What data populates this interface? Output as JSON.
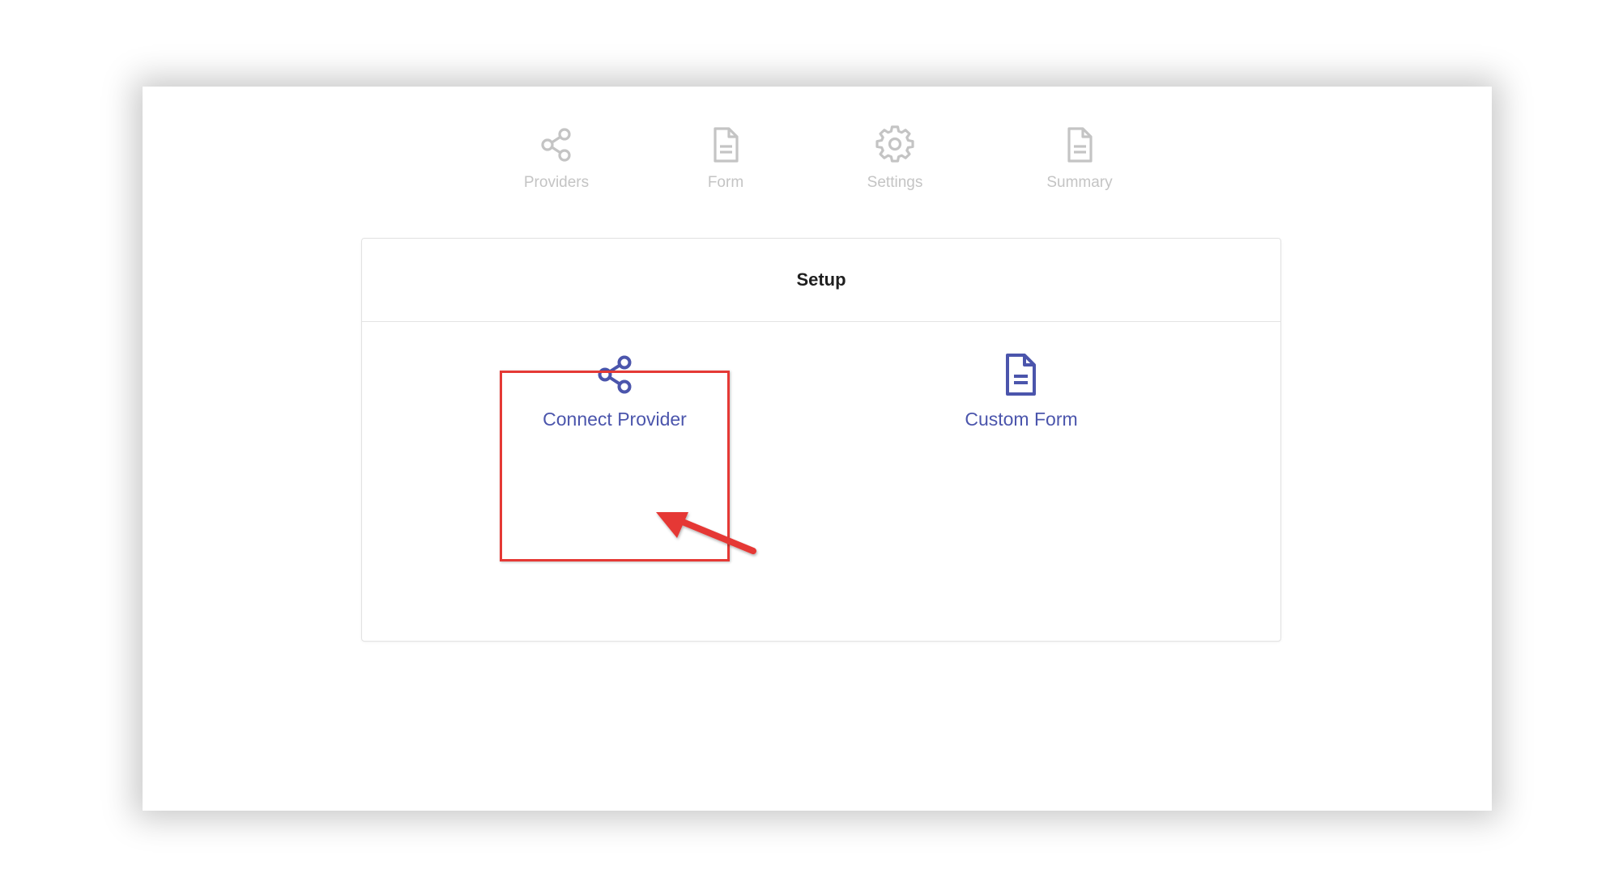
{
  "stepper": {
    "steps": [
      {
        "label": "Providers",
        "icon": "share-icon"
      },
      {
        "label": "Form",
        "icon": "document-icon"
      },
      {
        "label": "Settings",
        "icon": "gear-icon"
      },
      {
        "label": "Summary",
        "icon": "document-icon"
      }
    ]
  },
  "setup": {
    "title": "Setup",
    "options": [
      {
        "label": "Connect Provider",
        "icon": "share-icon"
      },
      {
        "label": "Custom Form",
        "icon": "document-icon"
      }
    ]
  },
  "colors": {
    "accent": "#4b55ac",
    "inactive": "#c4c4c4",
    "highlight": "#e53935"
  }
}
